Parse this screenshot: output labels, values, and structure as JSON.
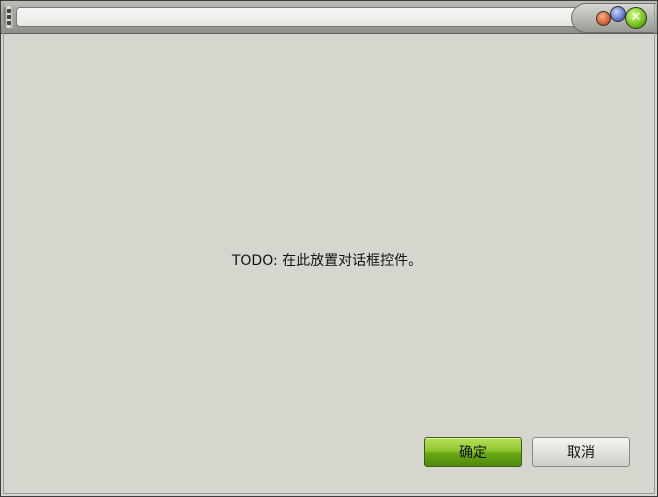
{
  "window": {
    "title": "",
    "controls": {
      "minimize_icon": "minimize-orb-icon",
      "maximize_icon": "maximize-orb-icon",
      "close_glyph": "✕"
    }
  },
  "content": {
    "message": "TODO: 在此放置对话框控件。"
  },
  "buttons": {
    "ok_label": "确定",
    "cancel_label": "取消"
  },
  "colors": {
    "ok_button": "#6aa815",
    "close_orb": "#6fbe18",
    "minimize_orb": "#d85a2a",
    "maximize_orb": "#5a73c8",
    "client_bg": "#d6d6ce"
  }
}
